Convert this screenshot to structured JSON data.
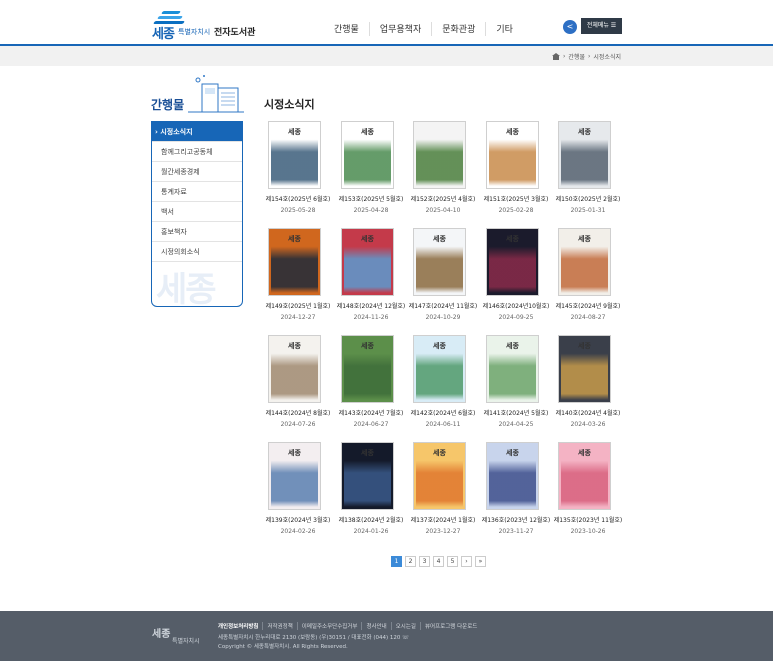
{
  "header": {
    "logo_word": "세종",
    "logo_sub": "특별자치시",
    "logo_lib": "전자도서관",
    "gnb": [
      "간행물",
      "업무용책자",
      "문화관광",
      "기타"
    ],
    "share_icon": "share-icon",
    "allmenu_label": "전체메뉴 ☰"
  },
  "breadcrumb": {
    "items": [
      "간행물",
      "시정소식지"
    ],
    "sep": "›"
  },
  "sidebar": {
    "title": "간행물",
    "items": [
      "› 시정소식지",
      "함께그리고공동체",
      "월간세종경제",
      "통계자료",
      "백서",
      "홍보책자",
      "시정의회소식"
    ],
    "watermark": "세종"
  },
  "content": {
    "title": "시정소식지"
  },
  "books": [
    {
      "label": "제154호(2025년 6월호)",
      "date": "2025-05-28",
      "bg": "#ffffff",
      "art": "#3b5d7a",
      "title": "세종"
    },
    {
      "label": "제153호(2025년 5월호)",
      "date": "2025-04-28",
      "bg": "#ffffff",
      "art": "#4a8a4f",
      "title": "세종"
    },
    {
      "label": "제152호(2025년 4월호)",
      "date": "2025-04-10",
      "bg": "#f4f4f4",
      "art": "#4a7f3c",
      "title": ""
    },
    {
      "label": "제151호(2025년 3월호)",
      "date": "2025-02-28",
      "bg": "#ffffff",
      "art": "#c88a4a",
      "title": "세종"
    },
    {
      "label": "제150호(2025년 2월호)",
      "date": "2025-01-31",
      "bg": "#e6e9ec",
      "art": "#556270",
      "title": "세종"
    },
    {
      "label": "제149호(2025년 1월호)",
      "date": "2024-12-27",
      "bg": "#d0671e",
      "art": "#1d2a3a",
      "title": "세종"
    },
    {
      "label": "제148호(2024년 12월호)",
      "date": "2024-11-26",
      "bg": "#c43a4a",
      "art": "#5a9bd0",
      "title": "세종"
    },
    {
      "label": "제147호(2024년 11월호)",
      "date": "2024-10-29",
      "bg": "#f4f6f8",
      "art": "#8a6a3e",
      "title": "세종"
    },
    {
      "label": "제146호(2024년10월호)",
      "date": "2024-09-25",
      "bg": "#1b1b2c",
      "art": "#8a2b4a",
      "title": "세종"
    },
    {
      "label": "제145호(2024년 9월호)",
      "date": "2024-08-27",
      "bg": "#f2efe9",
      "art": "#c26a3b",
      "title": "세종"
    },
    {
      "label": "제144호(2024년 8월호)",
      "date": "2024-07-26",
      "bg": "#f4f2ee",
      "art": "#a08970",
      "title": "세종"
    },
    {
      "label": "제143호(2024년 7월호)",
      "date": "2024-06-27",
      "bg": "#5c8f4a",
      "art": "#3e6d3a",
      "title": "세종"
    },
    {
      "label": "제142호(2024년 6월호)",
      "date": "2024-06-11",
      "bg": "#d8ecf6",
      "art": "#4f9a6a",
      "title": "세종"
    },
    {
      "label": "제141호(2024년 5월호)",
      "date": "2024-04-25",
      "bg": "#eaf3ea",
      "art": "#6ca46a",
      "title": "세종"
    },
    {
      "label": "제140호(2024년 4월호)",
      "date": "2024-03-26",
      "bg": "#3a3f4a",
      "art": "#c79b4a",
      "title": "세종"
    },
    {
      "label": "제139호(2024년 3월호)",
      "date": "2024-02-26",
      "bg": "#f3eef0",
      "art": "#5a7fb0",
      "title": "세종"
    },
    {
      "label": "제138호(2024년 2월호)",
      "date": "2024-01-26",
      "bg": "#141a2a",
      "art": "#3a5a8a",
      "title": "세종"
    },
    {
      "label": "제137호(2024년 1월호)",
      "date": "2023-12-27",
      "bg": "#f6c66a",
      "art": "#e0772e",
      "title": "세종"
    },
    {
      "label": "제136호(2023년 12월호)",
      "date": "2023-11-27",
      "bg": "#c8d4ec",
      "art": "#3e4f8c",
      "title": "세종"
    },
    {
      "label": "제135호(2023년 11월호)",
      "date": "2023-10-26",
      "bg": "#f4b3c4",
      "art": "#d8617e",
      "title": "세종"
    }
  ],
  "pager": [
    "1",
    "2",
    "3",
    "4",
    "5",
    "›",
    "»"
  ],
  "footer": {
    "logo": "세종",
    "logo_sub": "특별자치시",
    "links": [
      "개인정보처리방침",
      "저작권정책",
      "이메일주소무단수집거부",
      "청사안내",
      "오시는길",
      "뷰어프로그램 다운로드"
    ],
    "address": "세종특별자치시 한누리대로 2130 (보람동) (우)30151 / 대표전화 (044) 120 ☏",
    "copyright": "Copyright © 세종특별자치시. All Rights Reserved."
  }
}
